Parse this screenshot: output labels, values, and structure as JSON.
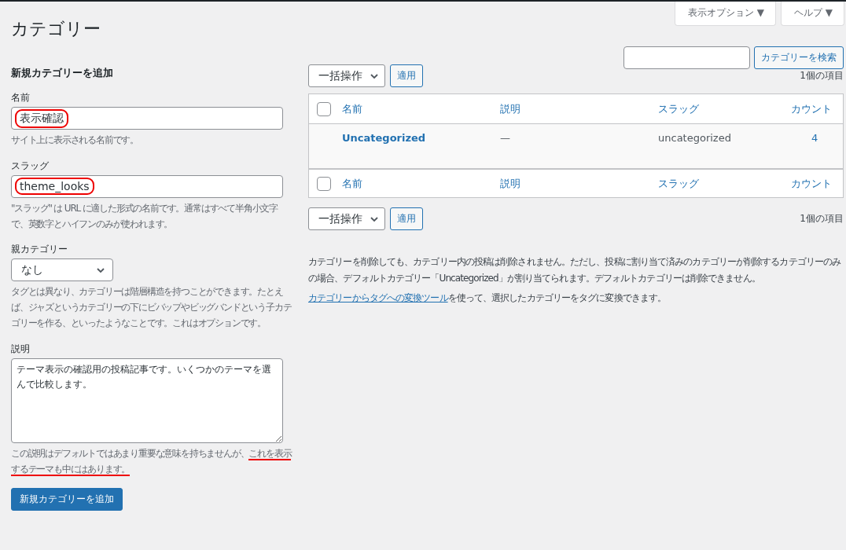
{
  "page_title": "カテゴリー",
  "screen_tabs": [
    {
      "label": "表示オプション",
      "glyph": "▼"
    },
    {
      "label": "ヘルプ",
      "glyph": "▼"
    }
  ],
  "search": {
    "button": "カテゴリーを検索"
  },
  "form": {
    "heading": "新規カテゴリーを追加",
    "fields": [
      {
        "kind": "input",
        "label": "名前",
        "value": "表示確認",
        "annotated": true,
        "help": "サイト上に表示される名前です。"
      },
      {
        "kind": "input",
        "label": "スラッグ",
        "value": "theme_looks",
        "annotated": true,
        "help": "\"スラッグ\" は URL に適した形式の名前です。通常はすべて半角小文字で、英数字とハイフンのみが使われます。"
      },
      {
        "kind": "select",
        "label": "親カテゴリー",
        "value": "なし",
        "help": "タグとは異なり、カテゴリーは階層構造を持つことができます。たとえば、ジャズというカテゴリーの下にビバップやビッグバンドという子カテゴリーを作る、といったようなことです。これはオプションです。"
      },
      {
        "kind": "textarea",
        "label": "説明",
        "value": "テーマ表示の確認用の投稿記事です。いくつかのテーマを選んで比較します。",
        "help": "この説明はデフォルトではあまり重要な意味を持ちませんが、",
        "help_underlined": "これを表示するテーマも中にはあります。"
      }
    ],
    "submit": "新規カテゴリーを追加"
  },
  "bulk_top": {
    "action": "一括操作",
    "apply": "適用",
    "count": "1個の項目"
  },
  "table": {
    "columns": [
      "名前",
      "説明",
      "スラッグ",
      "カウント"
    ],
    "footer_columns": [
      "名前",
      "説明",
      "スラッグ",
      "カウント"
    ],
    "rows": [
      {
        "name": "Uncategorized",
        "description": "—",
        "slug": "uncategorized",
        "count": "4"
      }
    ],
    "header_checked": false,
    "footer_checked": false
  },
  "bulk_bottom": {
    "action": "一括操作",
    "apply": "適用",
    "count": "1個の項目"
  },
  "notes": {
    "paragraph": "カテゴリーを削除しても、カテゴリー内の投稿は削除されません。ただし、投稿に割り当て済みのカテゴリーが削除するカテゴリーのみの場合、デフォルトカテゴリー「Uncategorized」が割り当てられます。デフォルトカテゴリーは削除できません。",
    "link": "カテゴリーからタグへの変換ツール",
    "link_suffix": "を使って、選択したカテゴリーをタグに変換できます。"
  }
}
